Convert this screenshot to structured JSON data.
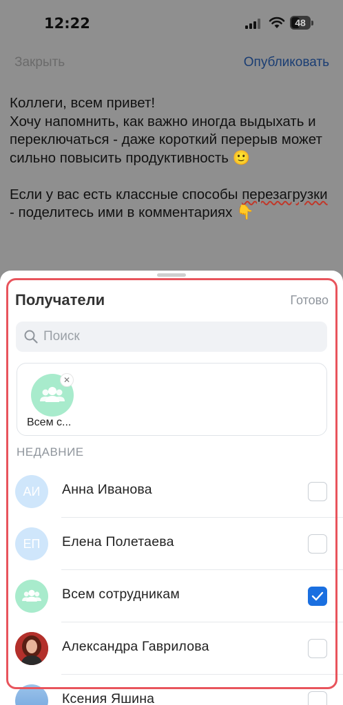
{
  "status_bar": {
    "time": "12:22",
    "battery": "48",
    "battery_level": 0.48
  },
  "composer": {
    "close_label": "Закрыть",
    "publish_label": "Опубликовать",
    "post_text_part1": "Коллеги, всем привет!\nХочу напомнить, как важно иногда выдыхать и переключаться - даже короткий перерыв может сильно повысить продуктивность 🙂\n\nЕсли у вас есть классные способы ",
    "post_text_misspelled": "перезагрузки",
    "post_text_part2": " - поделитесь ими в комментариях 👇"
  },
  "sheet": {
    "title": "Получатели",
    "done_label": "Готово",
    "search_placeholder": "Поиск",
    "selected_chip_label": "Всем с...",
    "selected_chip_icon": "group-icon",
    "section_recent": "НЕДАВНИЕ",
    "recipients": [
      {
        "name": "Анна Иванова",
        "initials": "АИ",
        "avatar": "initials",
        "checked": false
      },
      {
        "name": "Елена Полетаева",
        "initials": "ЕП",
        "avatar": "initials",
        "checked": false
      },
      {
        "name": "Всем сотрудникам",
        "initials": "",
        "avatar": "group-icon",
        "checked": true
      },
      {
        "name": "Александра Гаврилова",
        "initials": "",
        "avatar": "photo",
        "checked": false
      },
      {
        "name": "Ксения Яшина",
        "initials": "",
        "avatar": "photo",
        "checked": false
      }
    ]
  },
  "colors": {
    "accent": "#1a6fe0",
    "highlight": "#e8545c",
    "group_avatar": "#a8ebcc",
    "initials_avatar": "#cfe6fb"
  }
}
